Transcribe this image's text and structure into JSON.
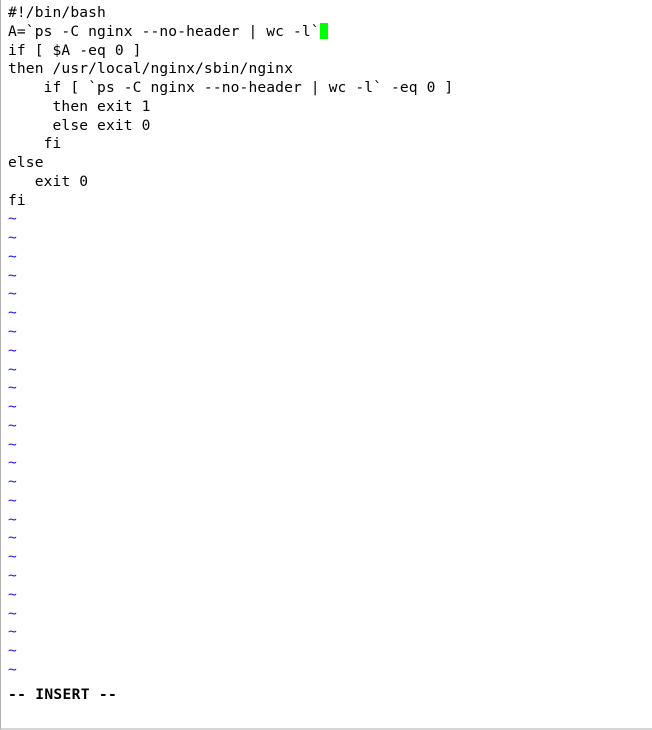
{
  "editor": {
    "app": "vim",
    "mode_text": "-- INSERT --",
    "filler_char": "~",
    "filler_count": 25,
    "cursor": {
      "line_index": 1,
      "column": 36,
      "color": "#00ff00",
      "shape": "block"
    },
    "colors": {
      "background": "#ffffff",
      "text": "#000000",
      "filler": "#2020e0",
      "cursor": "#00ff00",
      "status_text": "#000000",
      "border": "#b4b4b4"
    },
    "lines": [
      "#!/bin/bash",
      "A=`ps -C nginx --no-header | wc -l`",
      "if [ $A -eq 0 ]",
      "then /usr/local/nginx/sbin/nginx",
      "    if [ `ps -C nginx --no-header | wc -l` -eq 0 ]",
      "     then exit 1",
      "     else exit 0",
      "    fi",
      "else",
      "   exit 0",
      "fi"
    ]
  }
}
